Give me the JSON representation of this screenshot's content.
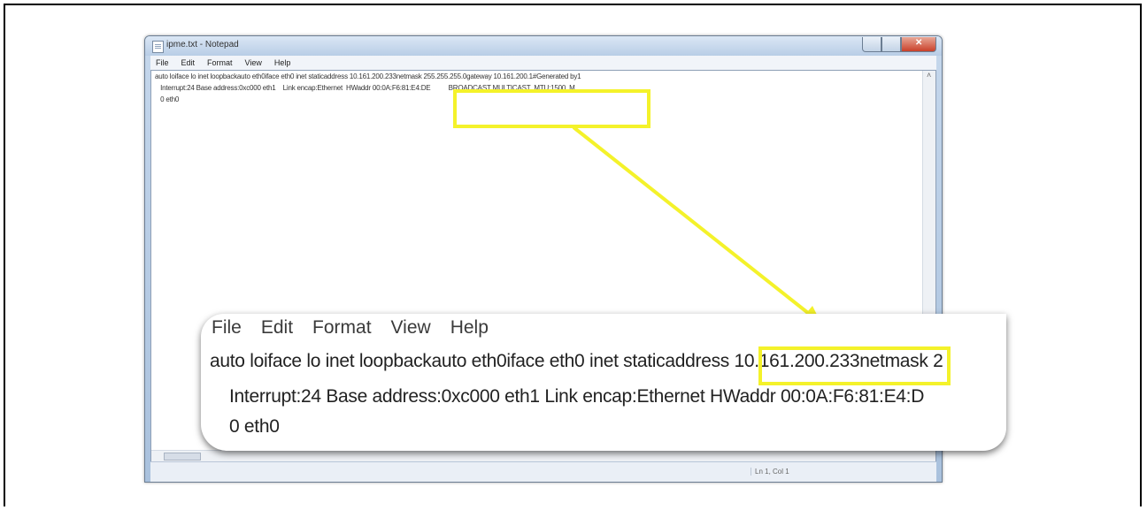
{
  "window": {
    "title": "ipme.txt - Notepad",
    "menu": [
      "File",
      "Edit",
      "Format",
      "View",
      "Help"
    ],
    "lines": [
      "auto loiface lo inet loopbackauto eth0iface eth0 inet staticaddress 10.161.200.233netmask 255.255.255.0gateway 10.161.200.1#Generated by1",
      "   Interrupt:24 Base address:0xc000 eth1    Link encap:Ethernet  HWaddr 00:0A:F6:81:E4:DE          BROADCAST MULTICAST  MTU:1500  M",
      "   0 eth0"
    ],
    "status": "Ln 1, Col 1"
  },
  "zoom": {
    "menu": [
      "File",
      "Edit",
      "Format",
      "View",
      "Help"
    ],
    "lines": [
      "auto loiface lo inet loopbackauto eth0iface eth0 inet staticaddress 10.161.200.233netmask 2",
      "Interrupt:24 Base address:0xc000 eth1      Link encap:Ethernet  HWaddr 00:0A:F6:81:E4:D",
      "0 eth0"
    ]
  },
  "colors": {
    "highlight": "#f4f22a",
    "close_button": "#c9402a"
  },
  "icons": [
    "notepad-icon",
    "minimize-icon",
    "maximize-icon",
    "close-icon"
  ]
}
